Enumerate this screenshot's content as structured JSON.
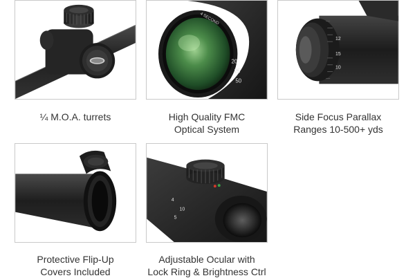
{
  "features": [
    {
      "caption": [
        "¼ M.O.A. turrets",
        ""
      ],
      "image": "scope-turrets"
    },
    {
      "caption": [
        "High Quality FMC",
        "Optical System"
      ],
      "image": "objective-lens"
    },
    {
      "caption": [
        "Side Focus Parallax",
        "Ranges 10-500+ yds"
      ],
      "image": "side-focus-knob"
    },
    {
      "caption": [
        "Protective Flip-Up",
        "Covers Included"
      ],
      "image": "flip-up-cover"
    },
    {
      "caption": [
        "Adjustable Ocular with",
        "Lock Ring & Brightness Ctrl"
      ],
      "image": "ocular-lens"
    }
  ],
  "image_markings": {
    "objective_ring": "4 SECOND",
    "objective_numbers": [
      "20",
      "25",
      "50"
    ],
    "side_focus_numbers": [
      "12",
      "15",
      "10"
    ],
    "ocular_numbers": [
      "4",
      "10",
      "5"
    ],
    "colors": {
      "scope_body": "#262626",
      "lens_green": "#2f6d3a",
      "tile_border": "#c9c9c9",
      "caption_text": "#333333"
    }
  }
}
